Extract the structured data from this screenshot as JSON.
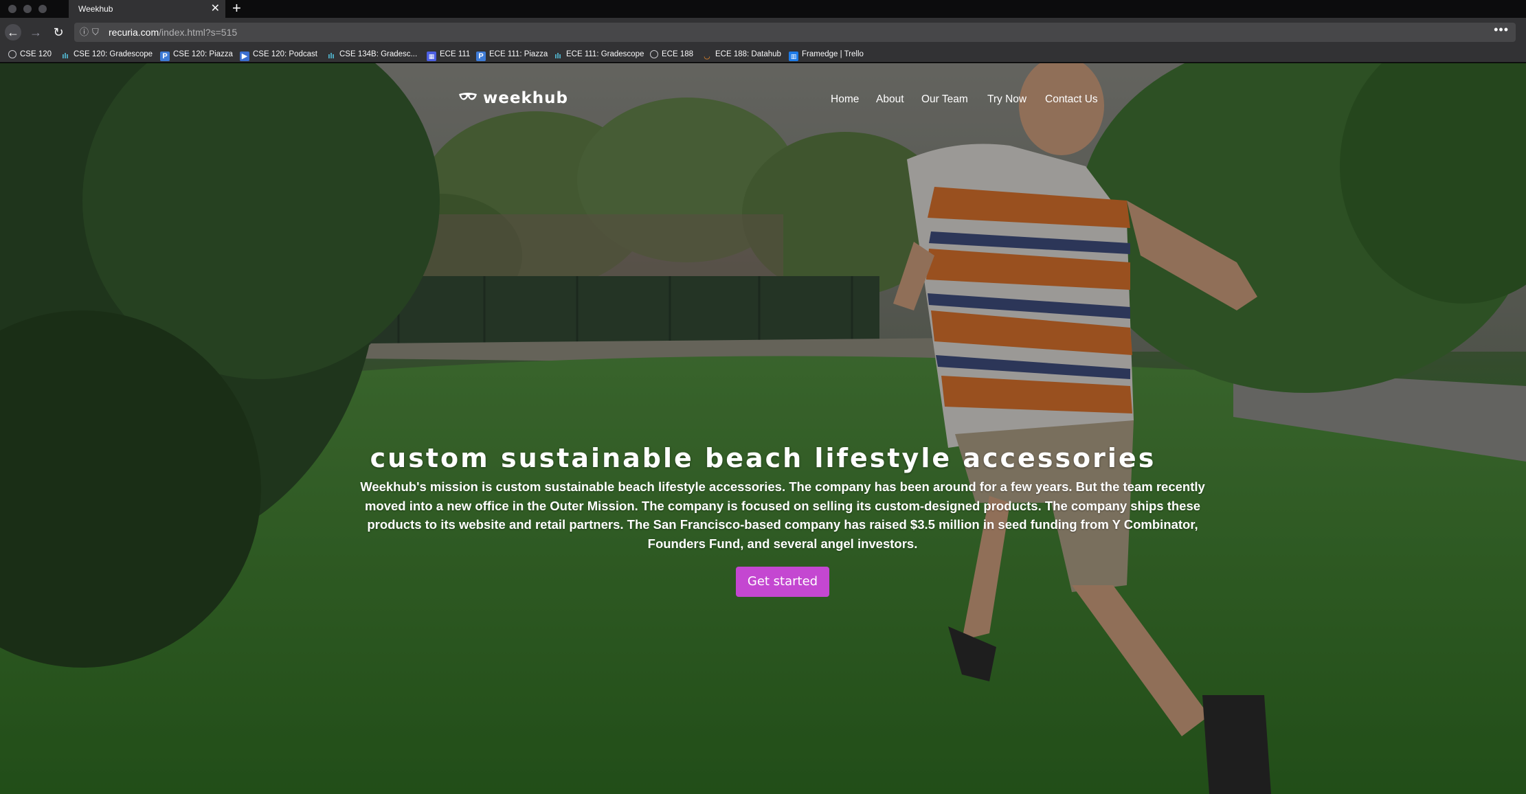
{
  "browser": {
    "tab_title": "Weekhub",
    "tab_close": "✕",
    "new_tab": "+",
    "url_domain": "recuria.com",
    "url_path": "/index.html?s=515",
    "menu_icon": "•••"
  },
  "bookmarks": [
    {
      "label": "CSE 120",
      "icon": "globe-icon"
    },
    {
      "label": "CSE 120: Gradescope",
      "icon": "bar-chart-icon"
    },
    {
      "label": "CSE 120: Piazza",
      "icon": "piazza-icon"
    },
    {
      "label": "CSE 120: Podcast",
      "icon": "podcast-icon"
    },
    {
      "label": "CSE 134B: Gradesc...",
      "icon": "bar-chart-icon"
    },
    {
      "label": "ECE 111",
      "icon": "calendar-icon"
    },
    {
      "label": "ECE 111: Piazza",
      "icon": "piazza-icon"
    },
    {
      "label": "ECE 111: Gradescope",
      "icon": "bar-chart-icon"
    },
    {
      "label": "ECE 188",
      "icon": "globe-icon"
    },
    {
      "label": "ECE 188: Datahub",
      "icon": "jupyter-icon"
    },
    {
      "label": "Framedge | Trello",
      "icon": "trello-icon"
    }
  ],
  "site": {
    "logo": "weekhub",
    "nav": {
      "home": "Home",
      "about": "About",
      "team": "Our Team",
      "try": "Try Now",
      "contact": "Contact Us"
    },
    "hero_title": "custom sustainable beach lifestyle accessories",
    "hero_text": "Weekhub's mission is custom sustainable beach lifestyle accessories. The company has been around for a few years. But the team recently moved into a new office in the Outer Mission. The company is focused on selling its custom-designed products. The company ships these products to its website and retail partners. The San Francisco-based company has raised $3.5 million in seed funding from Y Combinator, Founders Fund, and several angel investors.",
    "cta_label": "Get started"
  },
  "colors": {
    "cta": "#c447d1",
    "chrome": "#323234",
    "tabbar": "#0c0c0d"
  }
}
